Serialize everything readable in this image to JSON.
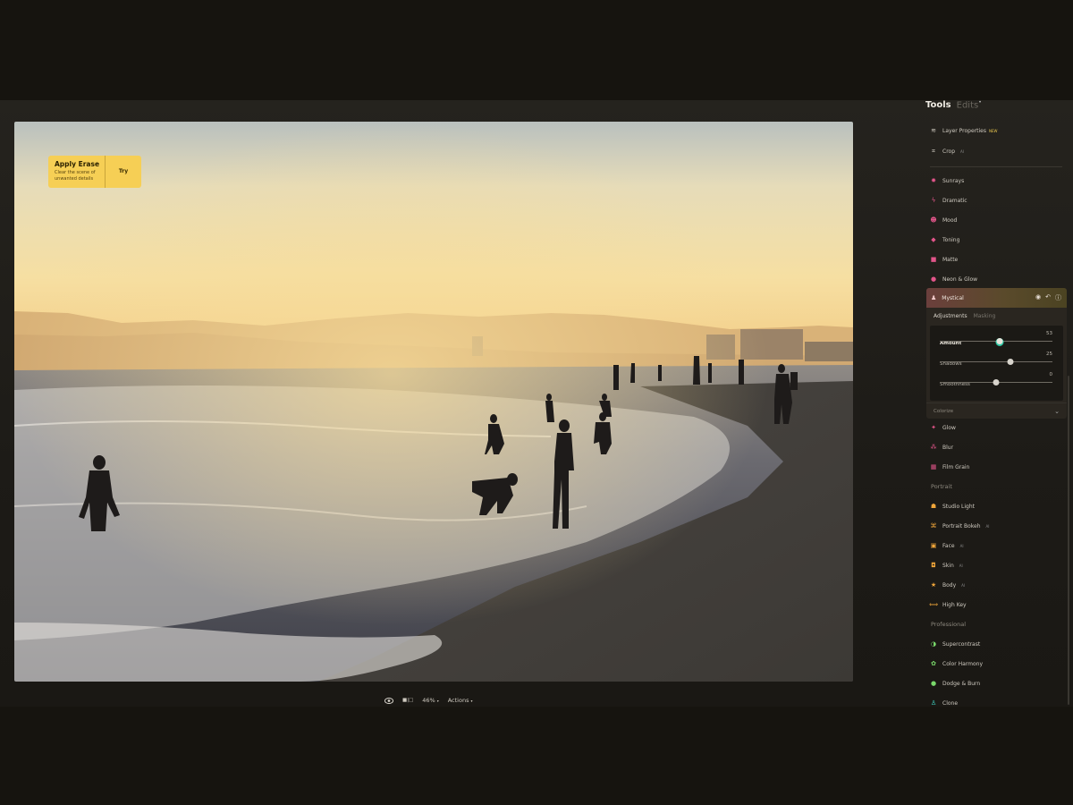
{
  "erase_banner": {
    "title": "Apply Erase",
    "description": "Clear the scene of unwanted details",
    "action": "Try"
  },
  "bottom_bar": {
    "compare_label": "■|□",
    "zoom": "46%",
    "actions": "Actions"
  },
  "panel": {
    "tabs": {
      "tools": "Tools",
      "edits": "Edits",
      "edits_badge": "•"
    },
    "top_items": [
      {
        "label": "Layer Properties",
        "badge": "NEW",
        "icon": "layers-icon",
        "color": "#cfcac0"
      },
      {
        "label": "Crop",
        "badge": "AI",
        "icon": "crop-icon",
        "color": "#cfcac0"
      }
    ],
    "creative_items": [
      {
        "label": "Sunrays",
        "icon": "sunrays-icon",
        "color": "#e2558a"
      },
      {
        "label": "Dramatic",
        "icon": "dramatic-icon",
        "color": "#e2558a"
      },
      {
        "label": "Mood",
        "icon": "mood-icon",
        "color": "#e2558a"
      },
      {
        "label": "Toning",
        "icon": "toning-icon",
        "color": "#e2558a"
      },
      {
        "label": "Matte",
        "icon": "matte-icon",
        "color": "#e2558a"
      },
      {
        "label": "Neon & Glow",
        "icon": "neon-glow-icon",
        "color": "#e2558a"
      }
    ],
    "mystical": {
      "label": "Mystical",
      "subtabs": {
        "adjustments": "Adjustments",
        "masking": "Masking"
      },
      "sliders": [
        {
          "label": "Amount",
          "value": 53,
          "min": 0,
          "max": 100
        },
        {
          "label": "Shadows",
          "value": 25,
          "min": -100,
          "max": 100
        },
        {
          "label": "Smoothness",
          "value": 0,
          "min": -100,
          "max": 100
        }
      ],
      "colorize": "Colorize"
    },
    "after_items": [
      {
        "label": "Glow",
        "icon": "glow-icon",
        "color": "#e2558a"
      },
      {
        "label": "Blur",
        "icon": "blur-icon",
        "color": "#e2558a"
      },
      {
        "label": "Film Grain",
        "icon": "film-grain-icon",
        "color": "#e2558a"
      }
    ],
    "portrait_title": "Portrait",
    "portrait_items": [
      {
        "label": "Studio Light",
        "badge": "",
        "icon": "studio-light-icon",
        "color": "#f0a63a"
      },
      {
        "label": "Portrait Bokeh",
        "badge": "AI",
        "icon": "portrait-bokeh-icon",
        "color": "#f0a63a"
      },
      {
        "label": "Face",
        "badge": "AI",
        "icon": "face-icon",
        "color": "#f0a63a"
      },
      {
        "label": "Skin",
        "badge": "AI",
        "icon": "skin-icon",
        "color": "#f0a63a"
      },
      {
        "label": "Body",
        "badge": "AI",
        "icon": "body-icon",
        "color": "#f0a63a"
      },
      {
        "label": "High Key",
        "badge": "",
        "icon": "high-key-icon",
        "color": "#f0a63a"
      }
    ],
    "professional_title": "Professional",
    "professional_items": [
      {
        "label": "Supercontrast",
        "icon": "supercontrast-icon",
        "color": "#7ad96b"
      },
      {
        "label": "Color Harmony",
        "icon": "color-harmony-icon",
        "color": "#7ad96b"
      },
      {
        "label": "Dodge & Burn",
        "icon": "dodge-burn-icon",
        "color": "#7ad96b"
      },
      {
        "label": "Clone",
        "icon": "clone-icon",
        "color": "#3fd0c0"
      }
    ]
  }
}
